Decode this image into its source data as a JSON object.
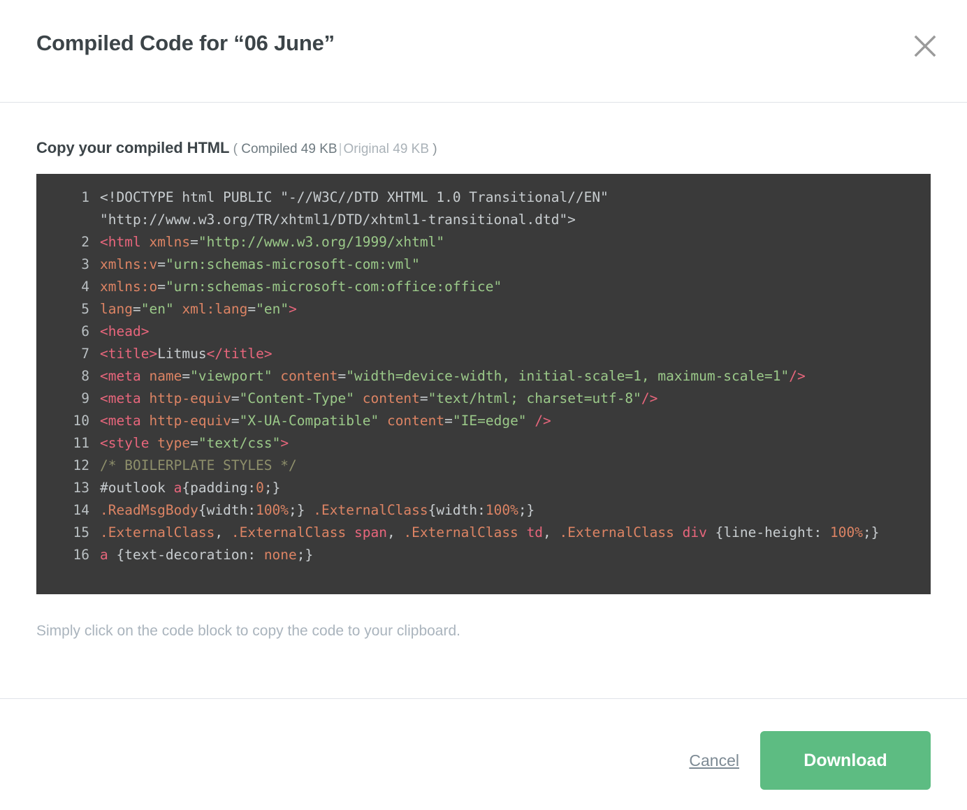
{
  "header": {
    "title": "Compiled Code for “06 June”",
    "close_icon": "close-icon"
  },
  "body": {
    "copy_heading": "Copy your compiled HTML",
    "paren_open": "(",
    "size_compiled": "Compiled 49 KB",
    "size_separator": "|",
    "size_original": "Original 49 KB",
    "paren_close": ")",
    "helper_text": "Simply click on the code block to copy the code to your clipboard."
  },
  "code": {
    "language": "html",
    "background_color": "#3a3a3a",
    "lines": [
      {
        "number": "1",
        "tokens": [
          {
            "text": "<!DOCTYPE html PUBLIC \"-//W3C//DTD XHTML 1.0 Transitional//EN\" \"http://www.w3.org/TR/xhtml1/DTD/xhtml1-transitional.dtd\">",
            "type": "plain"
          }
        ]
      },
      {
        "number": "2",
        "tokens": [
          {
            "text": "<html ",
            "type": "tag"
          },
          {
            "text": "xmlns",
            "type": "attr"
          },
          {
            "text": "=",
            "type": "punct"
          },
          {
            "text": "\"http://www.w3.org/1999/xhtml\"",
            "type": "string"
          }
        ]
      },
      {
        "number": "3",
        "tokens": [
          {
            "text": "xmlns:v",
            "type": "attr"
          },
          {
            "text": "=",
            "type": "punct"
          },
          {
            "text": "\"urn:schemas-microsoft-com:vml\"",
            "type": "string"
          }
        ]
      },
      {
        "number": "4",
        "tokens": [
          {
            "text": "xmlns:o",
            "type": "attr"
          },
          {
            "text": "=",
            "type": "punct"
          },
          {
            "text": "\"urn:schemas-microsoft-com:office:office\"",
            "type": "string"
          }
        ]
      },
      {
        "number": "5",
        "tokens": [
          {
            "text": "lang",
            "type": "attr"
          },
          {
            "text": "=",
            "type": "punct"
          },
          {
            "text": "\"en\"",
            "type": "string"
          },
          {
            "text": " ",
            "type": "plain"
          },
          {
            "text": "xml:lang",
            "type": "attr"
          },
          {
            "text": "=",
            "type": "punct"
          },
          {
            "text": "\"en\"",
            "type": "string"
          },
          {
            "text": ">",
            "type": "tag"
          }
        ]
      },
      {
        "number": "6",
        "tokens": [
          {
            "text": "<head>",
            "type": "tag"
          }
        ]
      },
      {
        "number": "7",
        "tokens": [
          {
            "text": "<title>",
            "type": "tag"
          },
          {
            "text": "Litmus",
            "type": "plain"
          },
          {
            "text": "</title>",
            "type": "tag"
          }
        ]
      },
      {
        "number": "8",
        "tokens": [
          {
            "text": "<meta ",
            "type": "tag"
          },
          {
            "text": "name",
            "type": "attr"
          },
          {
            "text": "=",
            "type": "punct"
          },
          {
            "text": "\"viewport\"",
            "type": "string"
          },
          {
            "text": " ",
            "type": "plain"
          },
          {
            "text": "content",
            "type": "attr"
          },
          {
            "text": "=",
            "type": "punct"
          },
          {
            "text": "\"width=device-width, initial-scale=1, maximum-scale=1\"",
            "type": "string"
          },
          {
            "text": "/>",
            "type": "tag"
          }
        ]
      },
      {
        "number": "9",
        "tokens": [
          {
            "text": "<meta ",
            "type": "tag"
          },
          {
            "text": "http-equiv",
            "type": "attr"
          },
          {
            "text": "=",
            "type": "punct"
          },
          {
            "text": "\"Content-Type\"",
            "type": "string"
          },
          {
            "text": " ",
            "type": "plain"
          },
          {
            "text": "content",
            "type": "attr"
          },
          {
            "text": "=",
            "type": "punct"
          },
          {
            "text": "\"text/html; charset=utf-8\"",
            "type": "string"
          },
          {
            "text": "/>",
            "type": "tag"
          }
        ]
      },
      {
        "number": "10",
        "tokens": [
          {
            "text": "<meta ",
            "type": "tag"
          },
          {
            "text": "http-equiv",
            "type": "attr"
          },
          {
            "text": "=",
            "type": "punct"
          },
          {
            "text": "\"X-UA-Compatible\"",
            "type": "string"
          },
          {
            "text": " ",
            "type": "plain"
          },
          {
            "text": "content",
            "type": "attr"
          },
          {
            "text": "=",
            "type": "punct"
          },
          {
            "text": "\"IE=edge\"",
            "type": "string"
          },
          {
            "text": " ",
            "type": "plain"
          },
          {
            "text": "/>",
            "type": "tag"
          }
        ]
      },
      {
        "number": "11",
        "tokens": [
          {
            "text": "<style ",
            "type": "tag"
          },
          {
            "text": "type",
            "type": "attr"
          },
          {
            "text": "=",
            "type": "punct"
          },
          {
            "text": "\"text/css\"",
            "type": "string"
          },
          {
            "text": ">",
            "type": "tag"
          }
        ]
      },
      {
        "number": "12",
        "tokens": [
          {
            "text": "/* BOILERPLATE STYLES */",
            "type": "comment"
          }
        ]
      },
      {
        "number": "13",
        "tokens": [
          {
            "text": "#outlook ",
            "type": "plain"
          },
          {
            "text": "a",
            "type": "elem"
          },
          {
            "text": "{padding:",
            "type": "prop"
          },
          {
            "text": "0",
            "type": "num"
          },
          {
            "text": ";}",
            "type": "prop"
          }
        ]
      },
      {
        "number": "14",
        "tokens": [
          {
            "text": ".ReadMsgBody",
            "type": "sel"
          },
          {
            "text": "{width:",
            "type": "prop"
          },
          {
            "text": "100%",
            "type": "num"
          },
          {
            "text": ";}",
            "type": "prop"
          },
          {
            "text": " ",
            "type": "plain"
          },
          {
            "text": ".ExternalClass",
            "type": "sel"
          },
          {
            "text": "{width:",
            "type": "prop"
          },
          {
            "text": "100%",
            "type": "num"
          },
          {
            "text": ";}",
            "type": "prop"
          }
        ]
      },
      {
        "number": "15",
        "tokens": [
          {
            "text": ".ExternalClass",
            "type": "sel"
          },
          {
            "text": ", ",
            "type": "prop"
          },
          {
            "text": ".ExternalClass",
            "type": "sel"
          },
          {
            "text": " ",
            "type": "plain"
          },
          {
            "text": "span",
            "type": "elem"
          },
          {
            "text": ", ",
            "type": "prop"
          },
          {
            "text": ".ExternalClass",
            "type": "sel"
          },
          {
            "text": " ",
            "type": "plain"
          },
          {
            "text": "td",
            "type": "elem"
          },
          {
            "text": ", ",
            "type": "prop"
          },
          {
            "text": ".ExternalClass",
            "type": "sel"
          },
          {
            "text": " ",
            "type": "plain"
          },
          {
            "text": "div",
            "type": "elem"
          },
          {
            "text": " {line-height: ",
            "type": "prop"
          },
          {
            "text": "100%",
            "type": "num"
          },
          {
            "text": ";}",
            "type": "prop"
          }
        ]
      },
      {
        "number": "16",
        "tokens": [
          {
            "text": "a",
            "type": "elem"
          },
          {
            "text": " {text-decoration: ",
            "type": "prop"
          },
          {
            "text": "none",
            "type": "num"
          },
          {
            "text": ";}",
            "type": "prop"
          }
        ]
      }
    ]
  },
  "footer": {
    "cancel_label": "Cancel",
    "download_label": "Download",
    "download_color": "#5dbc82"
  }
}
